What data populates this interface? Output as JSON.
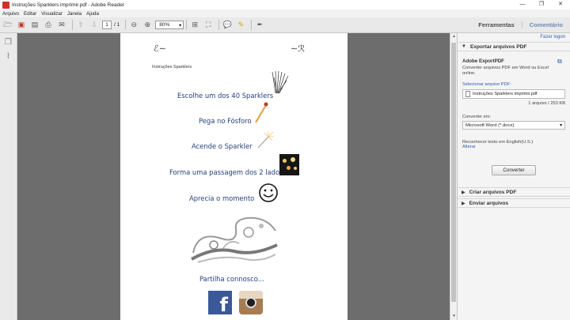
{
  "window": {
    "title": "Instruções Sparklers imprimir.pdf - Adobe Reader"
  },
  "menu": [
    "Arquivo",
    "Editar",
    "Visualizar",
    "Janela",
    "Ajuda"
  ],
  "toolbar": {
    "page_current": "1",
    "page_total": "/ 1",
    "zoom": "80%"
  },
  "tabs": {
    "tools": "Ferramentas",
    "comment": "Comentário"
  },
  "panel": {
    "hide_link": "Fazer logon",
    "export_header": "Exportar arquivos PDF",
    "service_title": "Adobe ExportPDF",
    "service_desc_1": "Converter arquivos PDF em Word ou Excel",
    "service_desc_2": "online.",
    "select_label": "Selecionar arquivo PDF:",
    "file_name": "Instruções Sparklers imprimir.pdf",
    "file_info": "1 arquivo / 253 KB",
    "convert_to_label": "Converter em:",
    "convert_format": "Microsoft Word (*.docx)",
    "recognize_text": "Reconhecer texto em English(U.S.)",
    "change_link": "Alterar",
    "convert_button": "Converter",
    "create_header": "Criar arquivos PDF",
    "send_header": "Enviar arquivos"
  },
  "pdf": {
    "heading": "Instruções Sparklers",
    "steps": [
      "Escolhe um dos 40 Sparklers",
      "Pega no Fósforo",
      "Acende o Sparkler",
      "Forma uma passagem dos 2 lados",
      "Aprecia o momento"
    ],
    "share": "Partilha connosco...",
    "fb_letter": "f"
  },
  "colors": {
    "pdf_text": "#253e7d",
    "accent_link": "#2a5db0",
    "fb_blue": "#3b5998"
  },
  "icons": [
    "open-icon",
    "create-icon",
    "save-icon",
    "print-icon",
    "email-icon",
    "prev-page-icon",
    "next-page-icon",
    "zoom-out-icon",
    "zoom-in-icon",
    "fit-page-icon",
    "fullscreen-icon",
    "comment-icon",
    "highlight-icon",
    "sign-icon"
  ]
}
